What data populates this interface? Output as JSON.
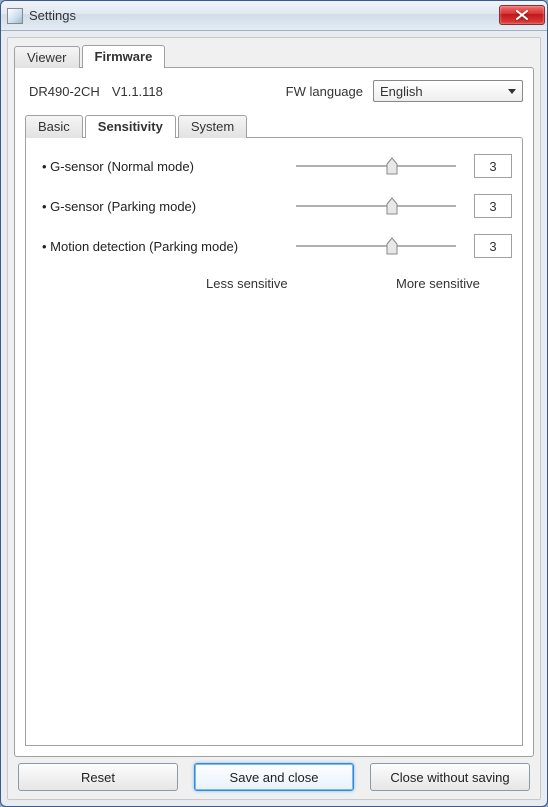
{
  "window": {
    "title": "Settings"
  },
  "outer_tabs": {
    "viewer": "Viewer",
    "firmware": "Firmware",
    "active": "firmware"
  },
  "fw_info": {
    "model": "DR490-2CH",
    "version": "V1.1.118",
    "lang_label": "FW language",
    "lang_value": "English"
  },
  "inner_tabs": {
    "basic": "Basic",
    "sensitivity": "Sensitivity",
    "system": "System",
    "active": "sensitivity"
  },
  "sliders": [
    {
      "label": "• G-sensor (Normal mode)",
      "value": 3,
      "min": 0,
      "max": 5
    },
    {
      "label": "• G-sensor (Parking mode)",
      "value": 3,
      "min": 0,
      "max": 5
    },
    {
      "label": "• Motion detection (Parking mode)",
      "value": 3,
      "min": 0,
      "max": 5
    }
  ],
  "scale": {
    "less": "Less sensitive",
    "more": "More sensitive"
  },
  "buttons": {
    "reset": "Reset",
    "save": "Save and close",
    "close": "Close without saving"
  }
}
